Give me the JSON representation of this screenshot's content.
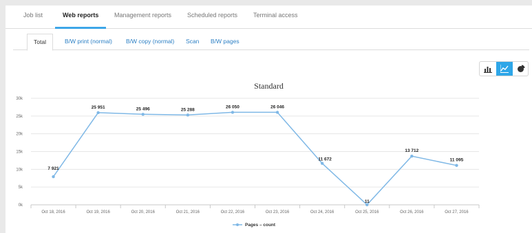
{
  "top_tabs": [
    {
      "label": "Job list",
      "active": false
    },
    {
      "label": "Web reports",
      "active": true
    },
    {
      "label": "Management reports",
      "active": false
    },
    {
      "label": "Scheduled reports",
      "active": false
    },
    {
      "label": "Terminal access",
      "active": false
    }
  ],
  "sub_tabs": [
    {
      "label": "Total",
      "active": true
    },
    {
      "label": "B/W print (normal)",
      "active": false
    },
    {
      "label": "B/W copy (normal)",
      "active": false
    },
    {
      "label": "Scan",
      "active": false
    },
    {
      "label": "B/W pages",
      "active": false
    }
  ],
  "chart_type_toggles": [
    {
      "icon": "bar-chart-icon",
      "active": false
    },
    {
      "icon": "line-chart-icon",
      "active": true
    },
    {
      "icon": "pie-chart-icon",
      "active": false
    }
  ],
  "colors": {
    "accent": "#2ea6e8",
    "series": "#7fb8e6"
  },
  "chart_data": {
    "type": "line",
    "title": "Standard",
    "categories": [
      "Oct 18, 2016",
      "Oct 19, 2016",
      "Oct 20, 2016",
      "Oct 21, 2016",
      "Oct 22, 2016",
      "Oct 23, 2016",
      "Oct 24, 2016",
      "Oct 25, 2016",
      "Oct 26, 2016",
      "Oct 27, 2016"
    ],
    "series": [
      {
        "name": "Pages – count",
        "values": [
          7921,
          25951,
          25496,
          25288,
          26050,
          26046,
          11672,
          11,
          13712,
          11095
        ],
        "labels": [
          "7 921",
          "25 951",
          "25 496",
          "25 288",
          "26 050",
          "26 046",
          "11 672",
          "11",
          "13 712",
          "11 095"
        ]
      }
    ],
    "y_ticks": [
      0,
      5000,
      10000,
      15000,
      20000,
      25000,
      30000
    ],
    "y_tick_labels": [
      "0k",
      "5k",
      "10k",
      "15k",
      "20k",
      "25k",
      "30k"
    ],
    "ylim": [
      0,
      30000
    ],
    "grid": true,
    "legend": "bottom-center"
  }
}
